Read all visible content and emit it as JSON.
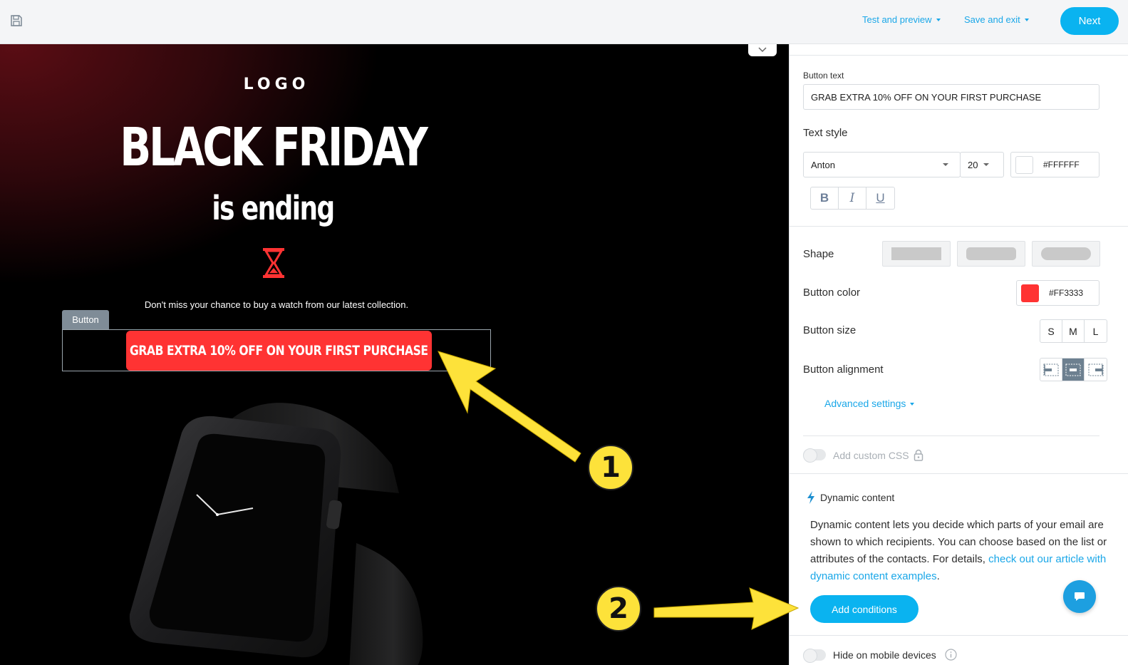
{
  "topbar": {
    "test_preview_label": "Test and preview",
    "save_exit_label": "Save and exit",
    "next_label": "Next"
  },
  "canvas": {
    "logo": "LOGO",
    "headline": "BLACK FRIDAY",
    "subline": "is ending",
    "tagline": "Don't miss your chance to buy a watch from our latest collection.",
    "block_label": "Button",
    "cta_text": "GRAB EXTRA 10% OFF ON YOUR FIRST PURCHASE",
    "background_colors": [
      "#5a0d14",
      "#000000"
    ],
    "icons": [
      "hourglass-icon",
      "watch-image"
    ]
  },
  "annotations": {
    "badge_1": "1",
    "badge_2": "2",
    "arrow_color": "#fde23a"
  },
  "panel": {
    "button_text_label": "Button text",
    "button_text_value": "GRAB EXTRA 10% OFF ON YOUR FIRST PURCHASE",
    "text_style_label": "Text style",
    "font_value": "Anton",
    "font_size_value": "20",
    "text_color_value": "#FFFFFF",
    "format_buttons": [
      "B",
      "I",
      "U"
    ],
    "shape_label": "Shape",
    "button_color_label": "Button color",
    "button_color_value": "#FF3333",
    "button_size_label": "Button size",
    "sizes": [
      "S",
      "M",
      "L"
    ],
    "button_alignment_label": "Button alignment",
    "alignment_active": "center",
    "advanced_settings_label": "Advanced settings",
    "custom_css_label": "Add custom CSS",
    "dynamic_content_label": "Dynamic content",
    "dynamic_text": "Dynamic content lets you decide which parts of your email are shown to which recipients. You can choose based on the list or attributes of the contacts. For details,",
    "dynamic_link": "check out our article with dynamic content examples",
    "dynamic_text_end": ".",
    "add_conditions_label": "Add conditions",
    "hide_mobile_label": "Hide on mobile devices",
    "accent_color": "#0ab3f0"
  }
}
